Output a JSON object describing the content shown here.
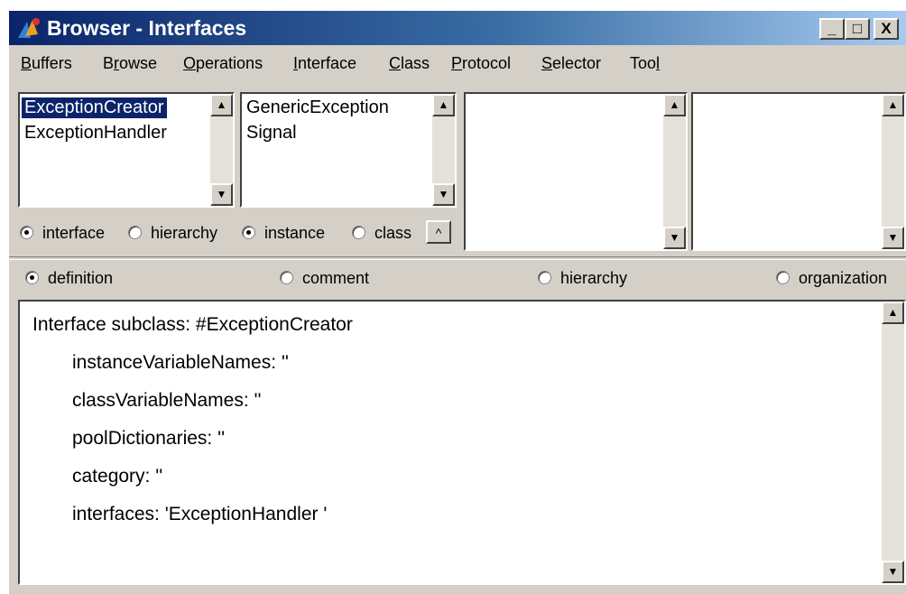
{
  "window": {
    "title": "Browser - Interfaces",
    "controls": {
      "minimize": "_",
      "maximize": "□",
      "close": "X"
    }
  },
  "menu": [
    {
      "label": "Buffers",
      "mnemonic": "B"
    },
    {
      "label": "Browse",
      "mnemonic": "r"
    },
    {
      "label": "Operations",
      "mnemonic": "O"
    },
    {
      "label": "Interface",
      "mnemonic": "I"
    },
    {
      "label": "Class",
      "mnemonic": "C"
    },
    {
      "label": "Protocol",
      "mnemonic": "P"
    },
    {
      "label": "Selector",
      "mnemonic": "S"
    },
    {
      "label": "Tool",
      "mnemonic": "l"
    }
  ],
  "panes": {
    "interfaces": {
      "items": [
        "ExceptionCreator",
        "ExceptionHandler"
      ],
      "selected_index": 0
    },
    "classes": {
      "items": [
        "GenericException",
        "Signal"
      ]
    },
    "protocols": {
      "items": []
    },
    "selectors": {
      "items": []
    }
  },
  "toggles": {
    "pane1": [
      {
        "label": "interface",
        "checked": true
      },
      {
        "label": "hierarchy",
        "checked": false
      }
    ],
    "pane2": [
      {
        "label": "instance",
        "checked": true
      },
      {
        "label": "class",
        "checked": false
      }
    ],
    "pane2_button": "^"
  },
  "view_mode": [
    {
      "label": "definition",
      "checked": true
    },
    {
      "label": "comment",
      "checked": false
    },
    {
      "label": "hierarchy",
      "checked": false
    },
    {
      "label": "organization",
      "checked": false
    }
  ],
  "definition_text": [
    "Interface subclass: #ExceptionCreator",
    "instanceVariableNames: ''",
    "classVariableNames: ''",
    "poolDictionaries: ''",
    "category: ''",
    "interfaces: 'ExceptionHandler '"
  ],
  "icons": {
    "app": "browser-app-icon",
    "scroll_up": "▲",
    "scroll_down": "▼"
  }
}
